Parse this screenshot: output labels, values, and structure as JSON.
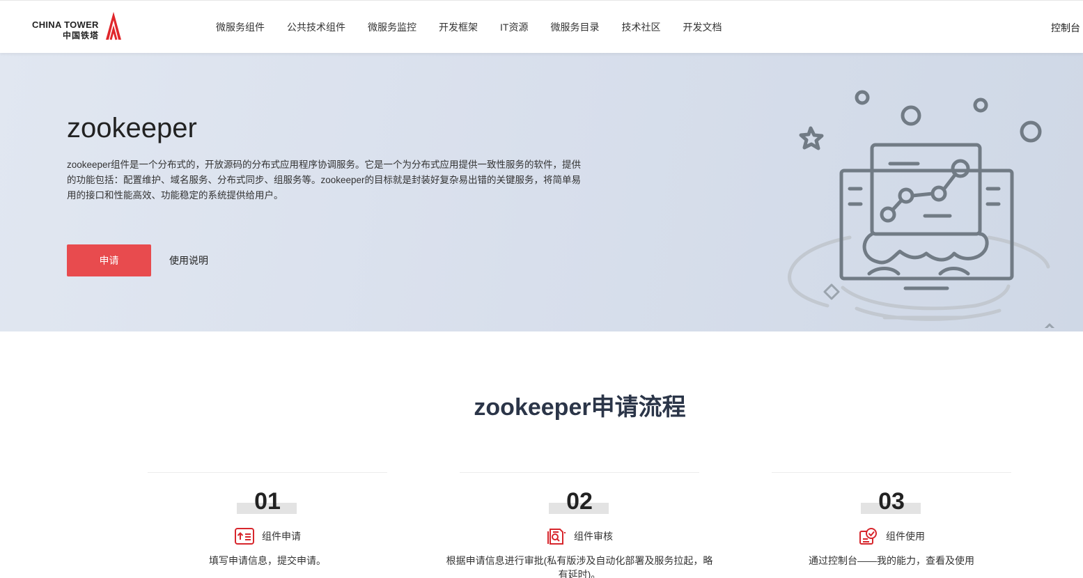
{
  "header": {
    "logo_en": "CHINA TOWER",
    "logo_cn": "中国铁塔",
    "nav": [
      "微服务组件",
      "公共技术组件",
      "微服务监控",
      "开发框架",
      "IT资源",
      "微服务目录",
      "技术社区",
      "开发文档"
    ],
    "console": "控制台"
  },
  "hero": {
    "title": "zookeeper",
    "description": "zookeeper组件是一个分布式的，开放源码的分布式应用程序协调服务。它是一个为分布式应用提供一致性服务的软件，提供的功能包括：配置维护、域名服务、分布式同步、组服务等。zookeeper的目标就是封装好复杂易出错的关键服务，将简单易用的接口和性能高效、功能稳定的系统提供给用户。",
    "apply_button": "申请",
    "guide_link": "使用说明"
  },
  "process": {
    "title": "zookeeper申请流程",
    "steps": [
      {
        "number": "01",
        "name": "组件申请",
        "icon": "form-upload-icon",
        "desc": "填写申请信息，提交申请。"
      },
      {
        "number": "02",
        "name": "组件审核",
        "icon": "document-review-icon",
        "desc": "根据申请信息进行审批(私有版涉及自动化部署及服务拉起，略有延时)。"
      },
      {
        "number": "03",
        "name": "组件使用",
        "icon": "check-badge-icon",
        "desc": "通过控制台——我的能力，查看及使用"
      }
    ]
  },
  "colors": {
    "brand_red": "#e84b4e",
    "hero_bg": "#d8dfec",
    "title_text": "#2b3548"
  }
}
